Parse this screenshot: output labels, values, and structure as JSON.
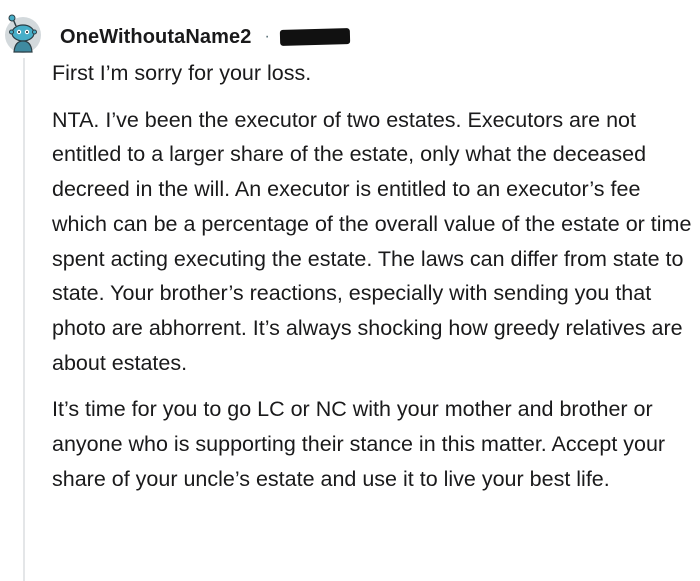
{
  "comment": {
    "username": "OneWithoutaName2",
    "separator": "·",
    "paragraphs": [
      "First I’m sorry for your loss.",
      "NTA. I’ve been the executor of two estates. Executors are not entitled to a larger share of the estate, only what the deceased decreed in the will. An executor is entitled to an executor’s fee which can be a percentage of the overall value of the estate or time spent acting executing the estate. The laws can differ from state to state. Your brother’s reactions, especially with sending you that photo are abhorrent. It’s always shocking how greedy relatives are about estates.",
      "It’s time for you to go LC or NC with your mother and brother or anyone who is supporting their stance in this matter. Accept your share of your uncle’s estate and use it to live your best life."
    ]
  },
  "colors": {
    "avatar_bg": "#d3d9dc",
    "avatar_head": "#47aec8",
    "thread_line": "#e4e6e8",
    "text": "#1a1a1b",
    "redaction": "#111111"
  },
  "icons": {
    "avatar": "snoo-avatar-icon"
  }
}
